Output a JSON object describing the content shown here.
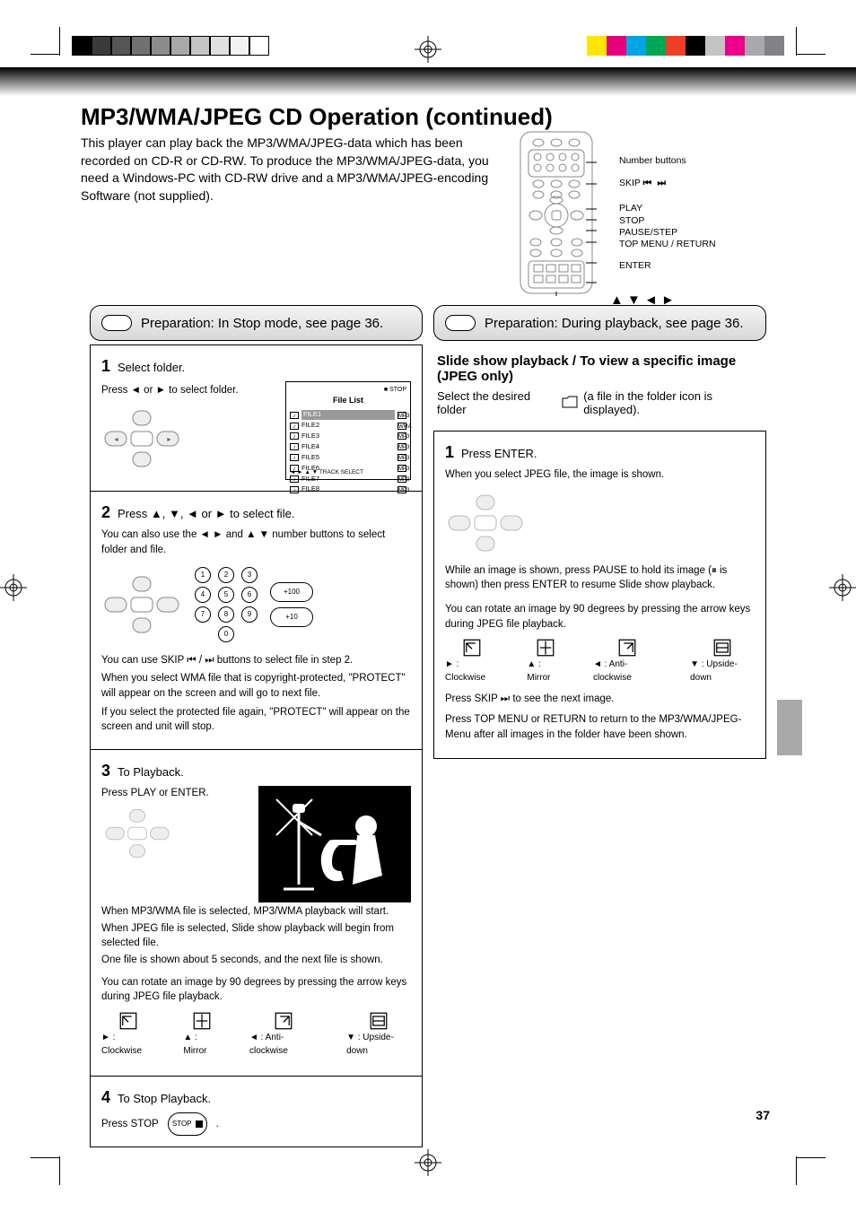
{
  "domain": "Document",
  "section_title": "MP3/WMA/JPEG CD Operation (continued)",
  "section_subtitle": "This player can play back the MP3/WMA/JPEG-data which has been recorded on CD-R or CD-RW. To produce the MP3/WMA/JPEG-data, you need a Windows-PC with CD-RW drive and a MP3/WMA/JPEG-encoding Software (not supplied).",
  "remote_labels": {
    "number": "Number buttons",
    "skip": "SKIP",
    "play": "PLAY",
    "stop": "STOP",
    "pause": "PAUSE/STEP",
    "top": "TOP MENU / RETURN",
    "arrows": "ENTER"
  },
  "left": {
    "header": "Preparation: In Stop mode, see page 36.",
    "cell1": {
      "num": "1",
      "label": "Select folder.",
      "body": "Press ◄ or ► to select folder.",
      "screenshot": {
        "title": "File List",
        "rows": [
          {
            "f": "FILE1",
            "t": "MP3"
          },
          {
            "f": "FILE2",
            "t": "WMA"
          },
          {
            "f": "FILE3",
            "t": "MP3"
          },
          {
            "f": "FILE4",
            "t": "MP3"
          },
          {
            "f": "FILE5",
            "t": "MP3"
          },
          {
            "f": "FILE6",
            "t": "MP3"
          },
          {
            "f": "FILE7",
            "t": "MP3"
          },
          {
            "f": "FILE8",
            "t": "MP3"
          }
        ],
        "footer": "◄ ► ▲ ▼ TRACK SELECT"
      }
    },
    "cell2": {
      "num": "2",
      "label": "Press ▲, ▼, ◄ or ► to select file.",
      "body1": "You can also use the ◄ ► and ▲ ▼ number buttons to select folder and file.",
      "keys": [
        "1",
        "2",
        "3",
        "4",
        "5",
        "6",
        "7",
        "8",
        "9",
        "0"
      ],
      "btn100": "+100",
      "btn10": "+10",
      "body2": "You can use SKIP ⏮ / ⏭ buttons to select file in step 2.",
      "body3": "When you select WMA file that is copyright-protected, \"PROTECT\" will appear on the screen and will go to next file.",
      "body4": "If you select the protected file again, \"PROTECT\" will appear on the screen and unit will stop."
    },
    "cell3": {
      "num": "3",
      "label": "To Playback.",
      "body1": "Press PLAY or ENTER.",
      "body2": "When MP3/WMA file is selected, MP3/WMA playback will start.",
      "body3": "When JPEG file is selected, Slide show playback will begin from selected file.",
      "body4": "One file is shown about 5 seconds, and the next file is shown.",
      "rotate_label": "You can rotate an image by 90 degrees by pressing the arrow keys during JPEG file playback.",
      "icons": [
        "► : Clockwise",
        "▲ : Mirror",
        "◄ : Anti-clockwise",
        "▼ : Upside-down"
      ]
    },
    "cell4": {
      "num": "4",
      "label": "To Stop Playback.",
      "body": "Press STOP"
    }
  },
  "right": {
    "header": "Preparation: During playback, see page 36.",
    "intro_title": "Slide show playback / To view a specific image (JPEG only)",
    "intro_body": "(a file in the folder icon is displayed).",
    "cell1": {
      "num": "1",
      "label": "Press ENTER.",
      "body1": "When you select JPEG file, the image is shown.",
      "body2": "While an image is shown, press PAUSE to hold its image (⏸ is shown) then press ENTER to resume Slide show playback.",
      "rotate_label": "You can rotate an image by 90 degrees by pressing the arrow keys during JPEG file playback.",
      "icons": [
        "► : Clockwise",
        "▲ : Mirror",
        "◄ : Anti-clockwise",
        "▼ : Upside-down"
      ],
      "skip_label": "Press SKIP ⏭ to see the next image.",
      "bottom": "Press TOP MENU or RETURN to return to the MP3/WMA/JPEG-Menu after all images in the folder have been shown."
    },
    "top_menu_return": "TOP MENU / RETURN"
  },
  "page_number": "37",
  "swatches_left": [
    "#000",
    "#3a3a3a",
    "#555",
    "#707070",
    "#8c8c8c",
    "#a8a8a8",
    "#c4c4c4",
    "#e0e0e0",
    "#f2f2f2",
    "#fff"
  ],
  "swatches_right": [
    "#ffe600",
    "#e6007e",
    "#00a5e3",
    "#00a651",
    "#ef3e23",
    "#000",
    "#c4c4c4",
    "#ec008c",
    "#a7a9ac",
    "#808285"
  ]
}
